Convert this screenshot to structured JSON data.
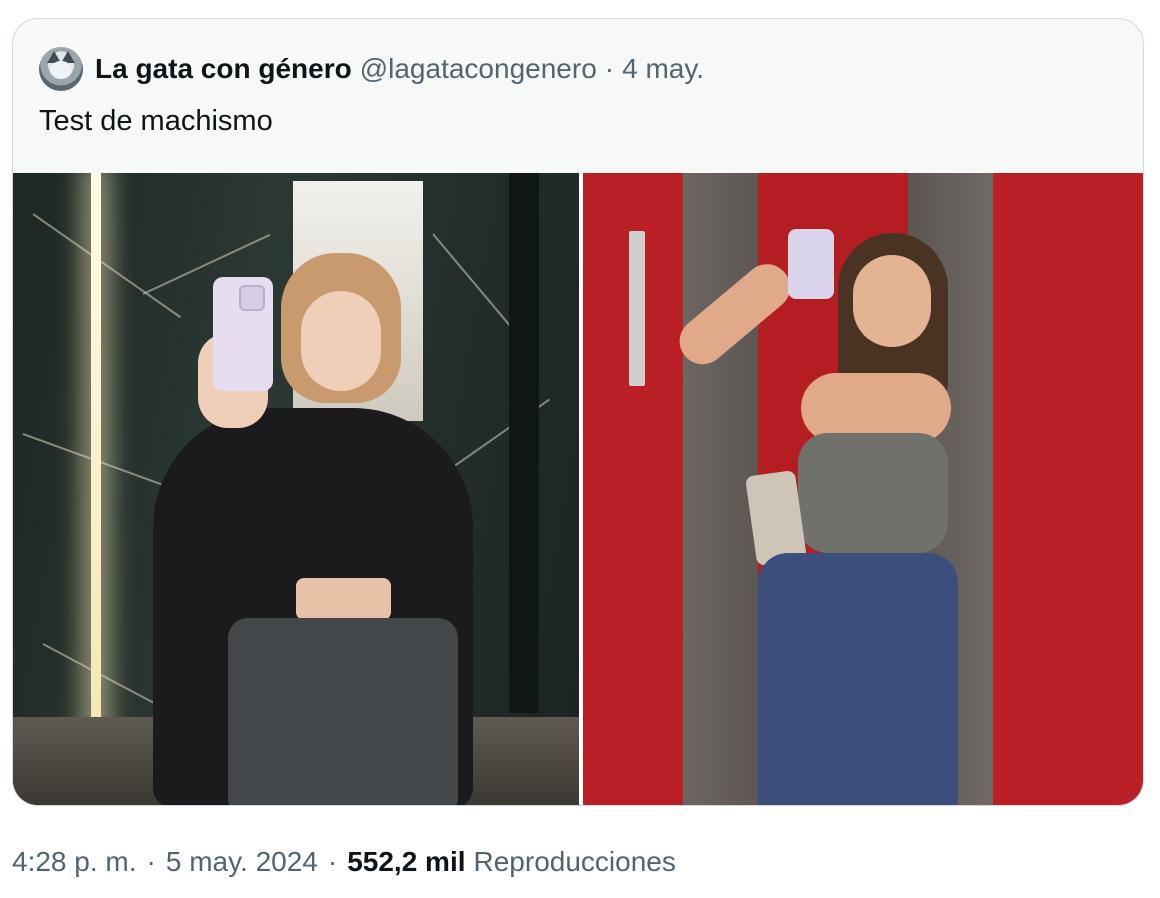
{
  "quoted_tweet": {
    "display_name": "La gata con género",
    "handle": "@lagatacongenero",
    "separator": "·",
    "date": "4 may.",
    "text": "Test de machismo",
    "avatar_icon": "cat-avatar-icon",
    "media": [
      {
        "description_icon": "photo-mirror-selfie-dark-marble"
      },
      {
        "description_icon": "photo-mirror-selfie-red-elevator"
      }
    ]
  },
  "tweet_meta": {
    "time": "4:28 p. m.",
    "separator": "·",
    "date": "5 may. 2024",
    "views_count": "552,2 mil",
    "views_label": "Reproducciones"
  },
  "colors": {
    "border": "#cfd9de",
    "secondary_text": "#536471",
    "primary_text": "#0f1419",
    "quote_bg": "#f7f9f9"
  }
}
